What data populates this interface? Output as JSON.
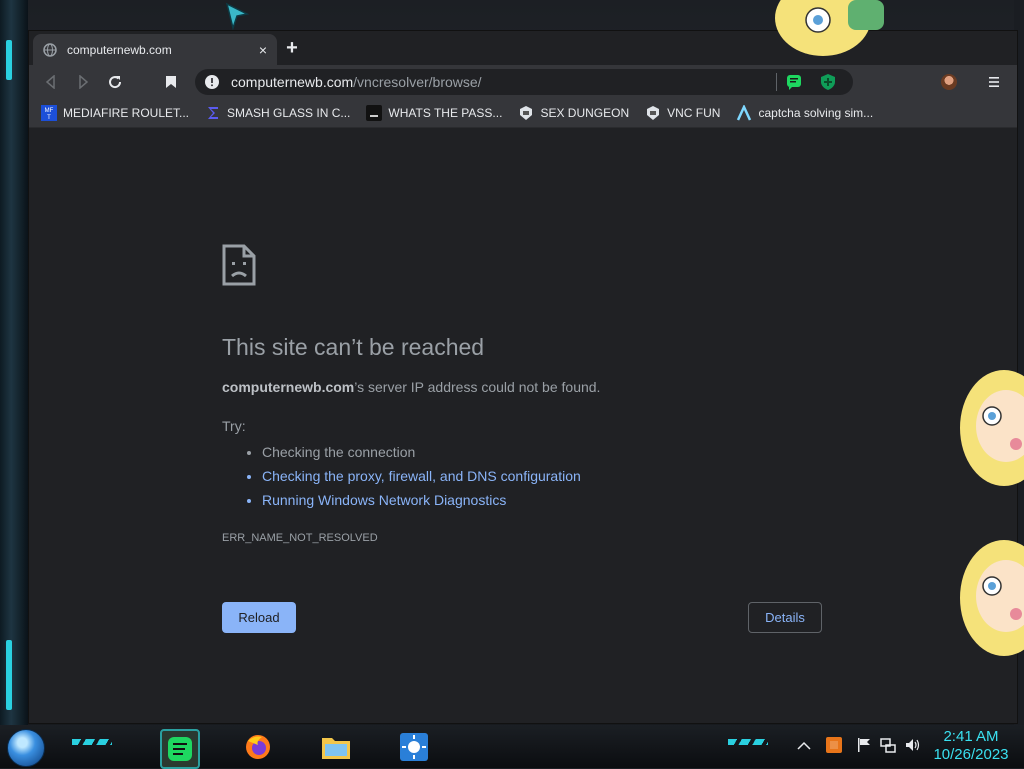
{
  "browser": {
    "tab": {
      "title": "computernewb.com",
      "close": "×"
    },
    "new_tab": "+",
    "url": {
      "host": "computernewb.com",
      "path": "/vncresolver/browse/"
    }
  },
  "bookmarks": [
    {
      "label": "MEDIAFIRE ROULET...",
      "icon": "mediafire-icon"
    },
    {
      "label": "SMASH GLASS IN C...",
      "icon": "sigma-icon"
    },
    {
      "label": "WHATS THE PASS...",
      "icon": "terminal-icon"
    },
    {
      "label": "SEX DUNGEON",
      "icon": "vnc-icon"
    },
    {
      "label": "VNC FUN",
      "icon": "vnc-icon"
    },
    {
      "label": "captcha solving sim...",
      "icon": "lambda-icon"
    }
  ],
  "error_page": {
    "title": "This site can’t be reached",
    "host": "computernewb.com",
    "description_suffix": "’s server IP address could not be found.",
    "try_label": "Try:",
    "suggestions": [
      "Checking the connection",
      "Checking the proxy, firewall, and DNS configuration",
      "Running Windows Network Diagnostics"
    ],
    "error_code": "ERR_NAME_NOT_RESOLVED",
    "reload_label": "Reload",
    "details_label": "Details"
  },
  "taskbar": {
    "apps": [
      "spotify",
      "firefox",
      "file-explorer",
      "weather"
    ],
    "clock_time": "2:41 AM",
    "clock_date": "10/26/2023"
  },
  "colors": {
    "accent": "#8ab4f8",
    "page_bg": "#202124",
    "clock": "#3ae0f0"
  }
}
